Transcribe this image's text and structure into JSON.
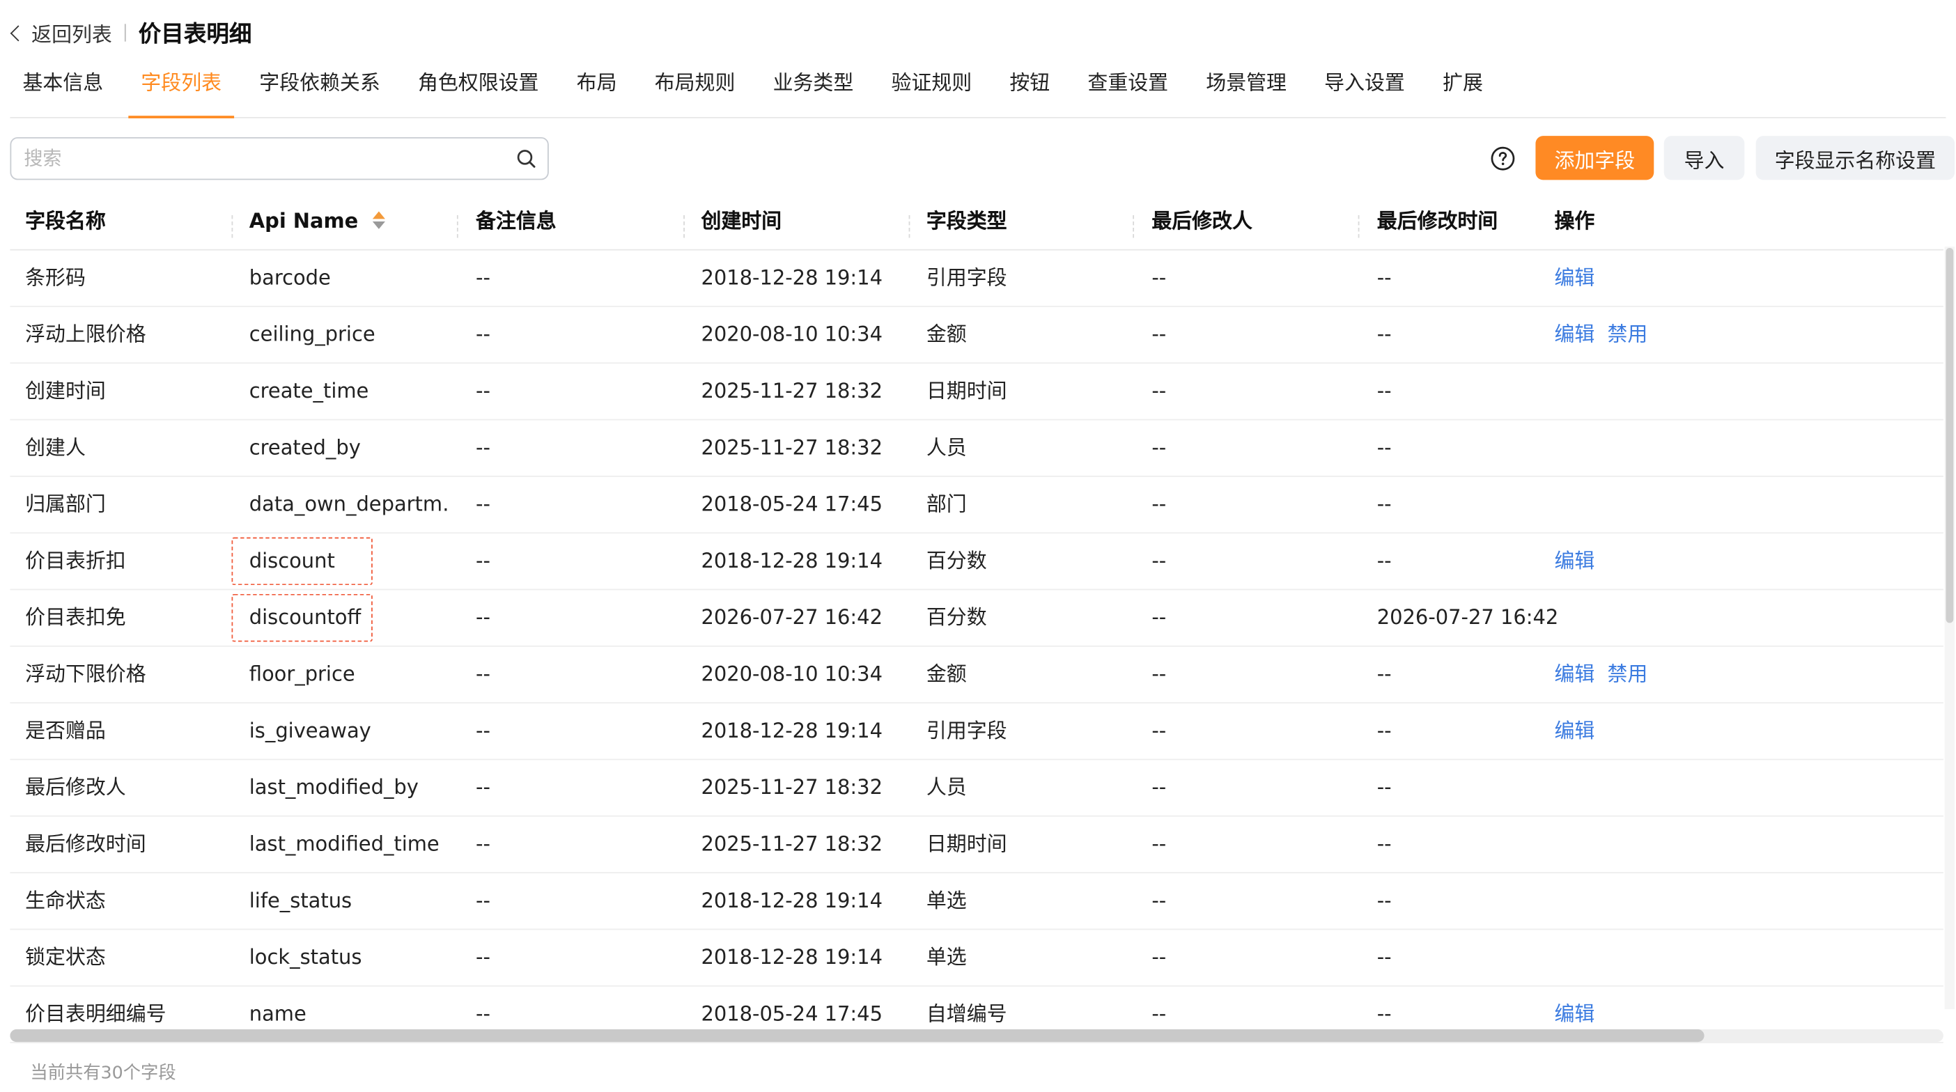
{
  "header": {
    "back_label": "返回列表",
    "title": "价目表明细"
  },
  "tabs": [
    {
      "label": "基本信息"
    },
    {
      "label": "字段列表"
    },
    {
      "label": "字段依赖关系"
    },
    {
      "label": "角色权限设置"
    },
    {
      "label": "布局"
    },
    {
      "label": "布局规则"
    },
    {
      "label": "业务类型"
    },
    {
      "label": "验证规则"
    },
    {
      "label": "按钮"
    },
    {
      "label": "查重设置"
    },
    {
      "label": "场景管理"
    },
    {
      "label": "导入设置"
    },
    {
      "label": "扩展"
    }
  ],
  "active_tab": "字段列表",
  "search": {
    "placeholder": "搜索",
    "value": ""
  },
  "toolbar": {
    "add_field": "添加字段",
    "import": "导入",
    "display_name_settings": "字段显示名称设置"
  },
  "table": {
    "columns": [
      "字段名称",
      "Api Name",
      "备注信息",
      "创建时间",
      "字段类型",
      "最后修改人",
      "最后修改时间",
      "操作"
    ],
    "sorted_column": "Api Name",
    "rows": [
      {
        "name": "条形码",
        "api": "barcode",
        "note": "--",
        "created": "2018-12-28 19:14",
        "type": "引用字段",
        "modifier": "--",
        "modified": "--",
        "actions": [
          "编辑"
        ]
      },
      {
        "name": "浮动上限价格",
        "api": "ceiling_price",
        "note": "--",
        "created": "2020-08-10 10:34",
        "type": "金额",
        "modifier": "--",
        "modified": "--",
        "actions": [
          "编辑",
          "禁用"
        ]
      },
      {
        "name": "创建时间",
        "api": "create_time",
        "note": "--",
        "created": "2025-11-27 18:32",
        "type": "日期时间",
        "modifier": "--",
        "modified": "--",
        "actions": []
      },
      {
        "name": "创建人",
        "api": "created_by",
        "note": "--",
        "created": "2025-11-27 18:32",
        "type": "人员",
        "modifier": "--",
        "modified": "--",
        "actions": []
      },
      {
        "name": "归属部门",
        "api": "data_own_departm…",
        "note": "--",
        "created": "2018-05-24 17:45",
        "type": "部门",
        "modifier": "--",
        "modified": "--",
        "actions": []
      },
      {
        "name": "价目表折扣",
        "api": "discount",
        "note": "--",
        "created": "2018-12-28 19:14",
        "type": "百分数",
        "modifier": "--",
        "modified": "--",
        "actions": [
          "编辑"
        ],
        "highlighted": true
      },
      {
        "name": "价目表扣免",
        "api": "discountoff",
        "note": "--",
        "created": "2026-07-27 16:42",
        "type": "百分数",
        "modifier": "--",
        "modified": "2026-07-27 16:42",
        "actions": [],
        "highlighted": true
      },
      {
        "name": "浮动下限价格",
        "api": "floor_price",
        "note": "--",
        "created": "2020-08-10 10:34",
        "type": "金额",
        "modifier": "--",
        "modified": "--",
        "actions": [
          "编辑",
          "禁用"
        ]
      },
      {
        "name": "是否赠品",
        "api": "is_giveaway",
        "note": "--",
        "created": "2018-12-28 19:14",
        "type": "引用字段",
        "modifier": "--",
        "modified": "--",
        "actions": [
          "编辑"
        ]
      },
      {
        "name": "最后修改人",
        "api": "last_modified_by",
        "note": "--",
        "created": "2025-11-27 18:32",
        "type": "人员",
        "modifier": "--",
        "modified": "--",
        "actions": []
      },
      {
        "name": "最后修改时间",
        "api": "last_modified_time",
        "note": "--",
        "created": "2025-11-27 18:32",
        "type": "日期时间",
        "modifier": "--",
        "modified": "--",
        "actions": []
      },
      {
        "name": "生命状态",
        "api": "life_status",
        "note": "--",
        "created": "2018-12-28 19:14",
        "type": "单选",
        "modifier": "--",
        "modified": "--",
        "actions": []
      },
      {
        "name": "锁定状态",
        "api": "lock_status",
        "note": "--",
        "created": "2018-12-28 19:14",
        "type": "单选",
        "modifier": "--",
        "modified": "--",
        "actions": []
      },
      {
        "name": "价目表明细编号",
        "api": "name",
        "note": "--",
        "created": "2018-05-24 17:45",
        "type": "自增编号",
        "modifier": "--",
        "modified": "--",
        "actions": [
          "编辑"
        ]
      }
    ]
  },
  "footer": {
    "count_text": "当前共有30个字段"
  },
  "colors": {
    "accent": "#ff8a24",
    "link": "#3b7be0",
    "highlight_border": "#f05a3a"
  },
  "icons": {
    "back": "chevron-left-icon",
    "search": "search-icon",
    "help": "help-circle-icon",
    "sort": "sort-icon"
  }
}
